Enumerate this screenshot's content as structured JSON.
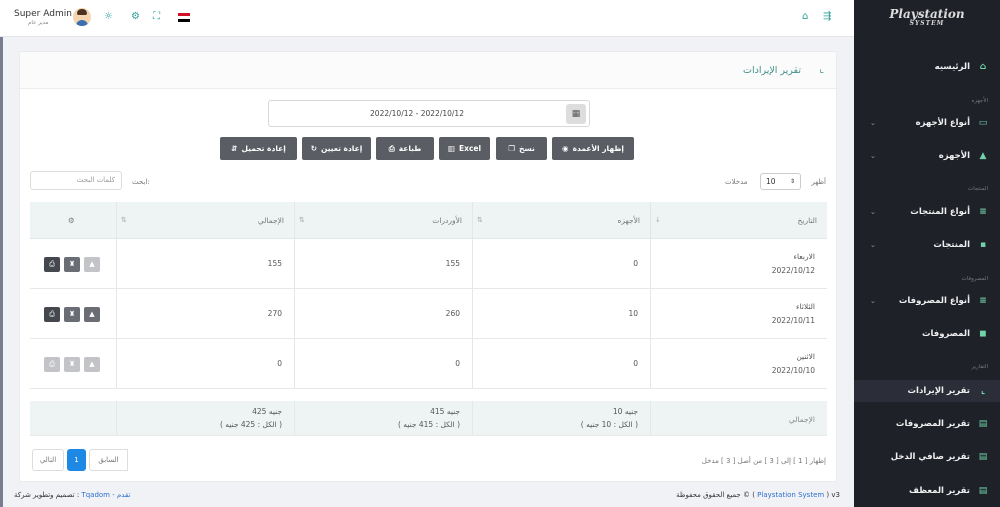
{
  "brand": {
    "logo_main": "Playstation",
    "logo_sub": "SYSTEM"
  },
  "user": {
    "name": "Super Admin",
    "role": "مدير عام"
  },
  "sidebar": {
    "items": [
      {
        "label": "الرئيسيه",
        "icon": "home-icon"
      },
      {
        "label": "أنواع الأجهزه",
        "icon": "monitor-icon",
        "chevron": true
      },
      {
        "label": "الأجهزه",
        "icon": "bell-icon",
        "chevron": true
      },
      {
        "label": "أنواع المنتجات",
        "icon": "list-icon",
        "chevron": true
      },
      {
        "label": "المنتجات",
        "icon": "box-icon",
        "chevron": true
      },
      {
        "label": "أنواع المصروفات",
        "icon": "list-icon",
        "chevron": true
      },
      {
        "label": "المصروفات",
        "icon": "wallet-icon"
      },
      {
        "label": "تقرير الإيرادات",
        "icon": "chart-icon",
        "active": true
      },
      {
        "label": "تقرير المصروفات",
        "icon": "report-icon"
      },
      {
        "label": "تقرير صافي الدخل",
        "icon": "report-icon"
      },
      {
        "label": "تقرير المعظف",
        "icon": "report-icon"
      }
    ],
    "sections": [
      "الأجهزه",
      "المنتجات",
      "المصروفات",
      "التقارير"
    ]
  },
  "page": {
    "title": "تقرير الإيرادات"
  },
  "date_range": "2022/10/12 - 2022/10/12",
  "buttons": {
    "columns": "إظهار الأعمدة",
    "copy": "نسخ",
    "excel": "Excel",
    "print": "طباعة",
    "reset": "إعادة تعيين",
    "reload": "إعادة تحميل"
  },
  "controls": {
    "show": "أظهر",
    "page_length": "10",
    "entries": "مدخلات",
    "search_label": "ابحث:",
    "search_placeholder": "كلمات البحث"
  },
  "table": {
    "headers": {
      "date": "التاريخ",
      "devices": "الأجهزه",
      "orders": "الأوردرات",
      "total": "الإجمالي"
    },
    "rows": [
      {
        "day": "الاربعاء",
        "date": "2022/10/12",
        "devices": "0",
        "orders": "155",
        "total": "155"
      },
      {
        "day": "الثلاثاء",
        "date": "2022/10/11",
        "devices": "10",
        "orders": "260",
        "total": "270"
      },
      {
        "day": "الاثنين",
        "date": "2022/10/10",
        "devices": "0",
        "orders": "0",
        "total": "0"
      }
    ],
    "footer": {
      "label": "الإجمالي",
      "devices": "10 جنيه",
      "devices_all": "( الكل : 10 جنيه )",
      "orders": "415 جنيه",
      "orders_all": "( الكل : 415 جنيه )",
      "total": "425 جنيه",
      "total_all": "( الكل : 425 جنيه )"
    }
  },
  "pagination": {
    "info": "إظهار [ 1 ] إلى [ 3 ] من أصل [ 3 ] مدخل",
    "prev": "السابق",
    "current": "1",
    "next": "التالي"
  },
  "footer": {
    "rights": "جميع الحقوق محفوظة ©",
    "system": "Playstation System",
    "version": "v3",
    "credit": "تصميم وتطوير شركة :",
    "company": "Tqadom - تقدم"
  },
  "colors": {
    "sidebar_bg": "#1f2129",
    "accent": "#2aa198",
    "button": "#5a5d63",
    "page_active": "#1e88e5"
  }
}
